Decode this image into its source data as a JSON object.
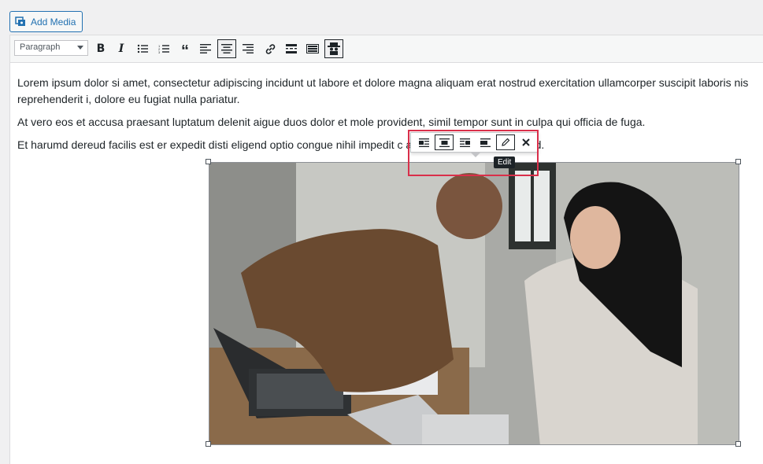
{
  "header": {
    "add_media_label": "Add Media"
  },
  "toolbar": {
    "format_select": "Paragraph",
    "buttons": [
      "Bold",
      "Italic",
      "Bulleted list",
      "Numbered list",
      "Blockquote",
      "Align left",
      "Align center",
      "Align right",
      "Insert/edit link",
      "Insert Read More tag",
      "Toolbar Toggle",
      "Cleanup"
    ]
  },
  "content": {
    "p1_line1": "Lorem ipsum dolor si amet, consectetur adipiscing incidunt ut labore et dolore magna aliquam erat nostrud exercitation ullamcorper suscipit laboris nis",
    "p1_line2": "reprehenderit i, dolore eu fugiat nulla pariatur.",
    "p2": "At vero eos et accusa praesant luptatum delenit aigue duos dolor et mole provident, simil tempor sunt in culpa qui officia de fuga.",
    "p3": "Et harumd dereud facilis est er expedit disti eligend optio congue nihil impedit c                          a est, omnis dolor repellend."
  },
  "image_toolbar": {
    "tooltip": "Edit",
    "tools": [
      "align-left",
      "align-center",
      "align-right",
      "align-none",
      "edit",
      "remove"
    ]
  },
  "colors": {
    "accent": "#2271b1",
    "highlight": "#d92f4a"
  }
}
